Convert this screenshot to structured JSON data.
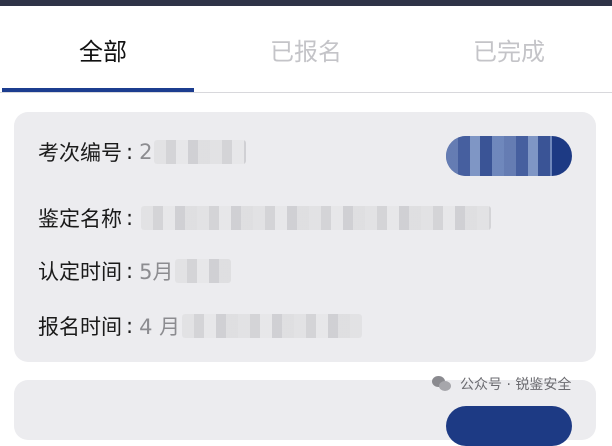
{
  "tabs": [
    {
      "label": "全部",
      "active": true
    },
    {
      "label": "已报名",
      "active": false
    },
    {
      "label": "已完成",
      "active": false
    }
  ],
  "card": {
    "exam_no": {
      "label": "考次编号",
      "sep": ":",
      "value": "2"
    },
    "name": {
      "label": "鉴定名称",
      "sep": ":",
      "value": ""
    },
    "cert_time": {
      "label": "认定时间",
      "sep": ":",
      "value": "5月"
    },
    "reg_time": {
      "label": "报名时间",
      "sep": ":",
      "value": "4 月"
    }
  },
  "watermark": {
    "text": "公众号 · 锐鉴安全"
  },
  "colors": {
    "accent": "#1c3d8f",
    "card_bg": "#ececef",
    "tab_inactive": "#c4c4c8",
    "topbar": "#2f3347"
  },
  "icons": {
    "watermark_icon": "wechat-icon"
  }
}
